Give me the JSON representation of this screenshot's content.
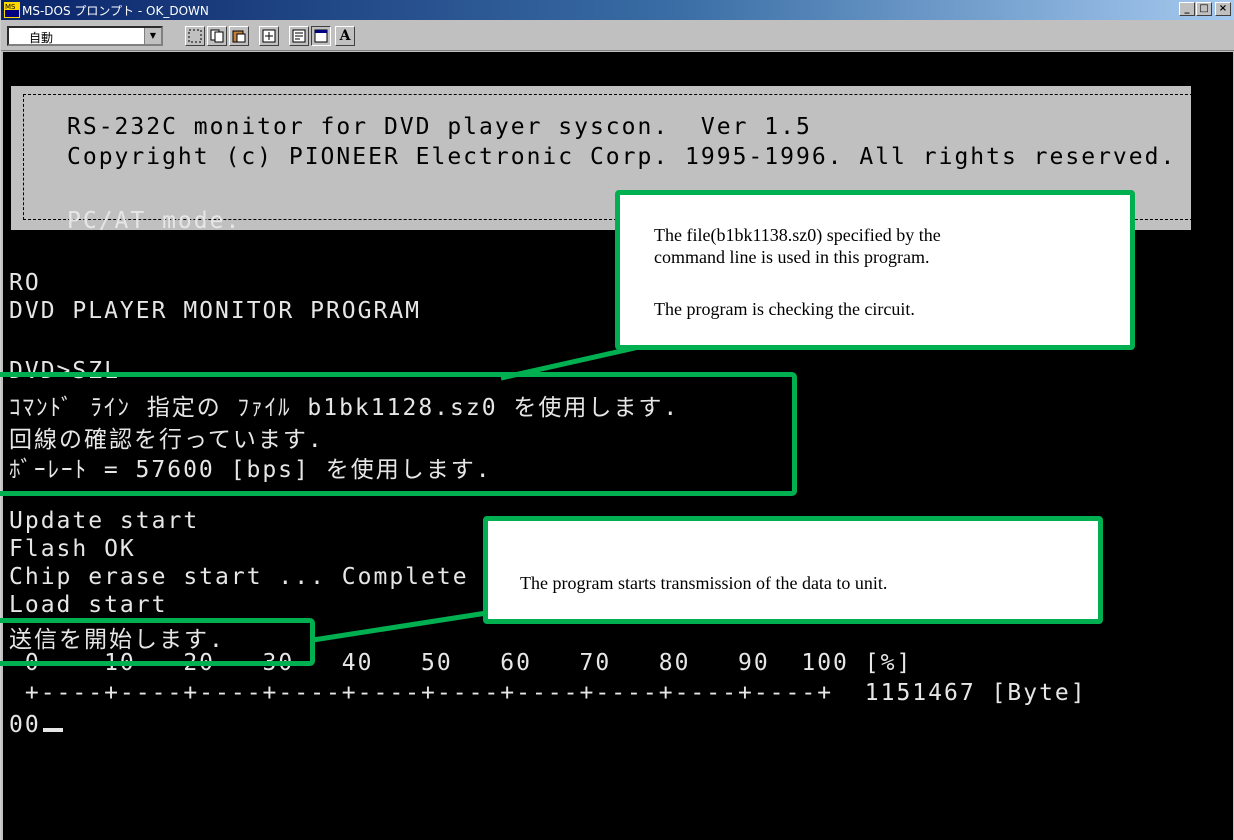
{
  "window": {
    "title": "MS-DOS プロンプト - OK_DOWN",
    "icon_label": "MS",
    "controls": {
      "minimize": "_",
      "maximize": "□",
      "close": "×"
    }
  },
  "toolbar": {
    "font_size_value": "自動",
    "icons": [
      "mark-icon",
      "copy-icon",
      "paste-icon",
      "fullscreen-icon",
      "properties-icon",
      "background-icon",
      "font-icon"
    ],
    "font_button_label": "A"
  },
  "console": {
    "banner_line1": "RS-232C monitor for DVD player syscon.  Ver 1.5",
    "banner_line2": "Copyright (c) PIONEER Electronic Corp. 1995-1996. All rights reserved.",
    "mode_line": "PC/AT mode.",
    "ro_line": "RO",
    "program_line": "DVD PLAYER MONITOR PROGRAM",
    "prompt_line": "DVD>SZL",
    "jp_line1": "ｺﾏﾝﾄﾞ ﾗｲﾝ 指定の ﾌｧｲﾙ b1bk1128.sz0 を使用します.",
    "jp_line2": "回線の確認を行っています.",
    "jp_line3": "ﾎﾞｰﾚｰﾄ = 57600 [bps] を使用します.",
    "update_line": "Update start",
    "flash_line": "Flash OK",
    "erase_line": "Chip erase start ... Complete",
    "load_line": "Load start",
    "send_line": "送信を開始します.",
    "scale_line": " 0    10   20   30   40   50   60   70   80   90  100 [%]",
    "ruler_line": " +----+----+----+----+----+----+----+----+----+----+  1151467 [Byte]",
    "progress_value": "00"
  },
  "annotations": {
    "callout1_line1": "The file(b1bk1138.sz0) specified by the",
    "callout1_line2": "command line is used in this program.",
    "callout1_line3": "The program is checking the circuit.",
    "callout2_text": "The program starts transmission of the data to unit."
  },
  "colors": {
    "highlight_green": "#00b050",
    "console_bg": "#000000",
    "console_text": "#e6e6e6",
    "titlebar": "#0a246a"
  }
}
